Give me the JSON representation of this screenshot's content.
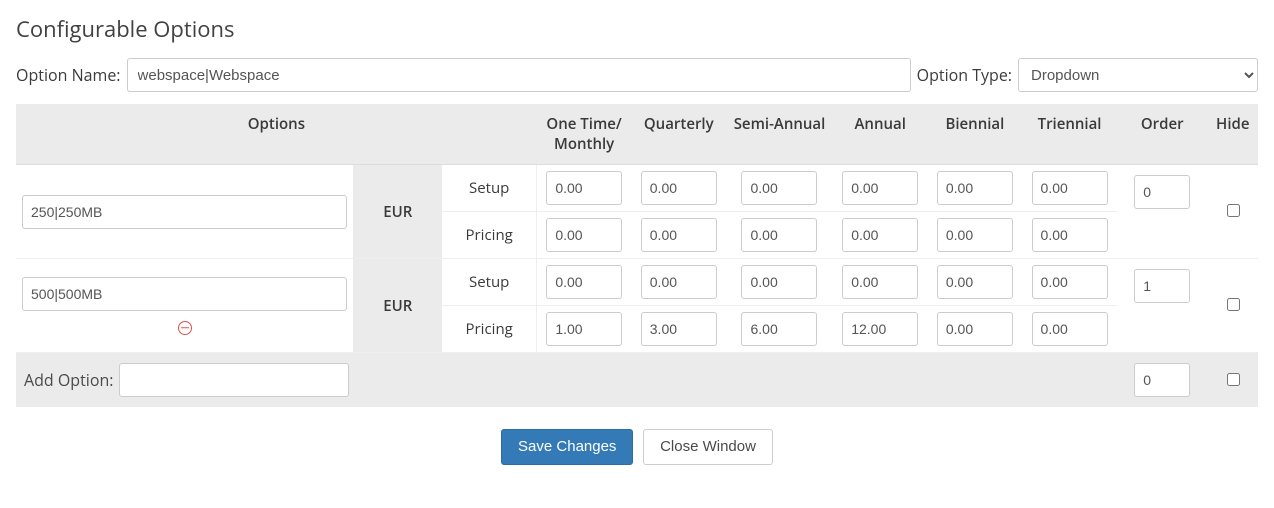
{
  "title": "Configurable Options",
  "labels": {
    "option_name": "Option Name:",
    "option_type": "Option Type:",
    "add_option": "Add Option:",
    "setup": "Setup",
    "pricing": "Pricing"
  },
  "option_name_value": "webspace|Webspace",
  "option_type_value": "Dropdown",
  "option_type_options": [
    "Dropdown"
  ],
  "headings": {
    "options": "Options",
    "one_time_monthly": "One Time/ Monthly",
    "quarterly": "Quarterly",
    "semi_annual": "Semi-Annual",
    "annual": "Annual",
    "biennial": "Biennial",
    "triennial": "Triennial",
    "order": "Order",
    "hide": "Hide"
  },
  "rows": [
    {
      "name": "250|250MB",
      "currency": "EUR",
      "setup": {
        "monthly": "0.00",
        "quarterly": "0.00",
        "semi": "0.00",
        "annual": "0.00",
        "biennial": "0.00",
        "triennial": "0.00"
      },
      "pricing": {
        "monthly": "0.00",
        "quarterly": "0.00",
        "semi": "0.00",
        "annual": "0.00",
        "biennial": "0.00",
        "triennial": "0.00"
      },
      "order": "0",
      "hide": false,
      "removable": false
    },
    {
      "name": "500|500MB",
      "currency": "EUR",
      "setup": {
        "monthly": "0.00",
        "quarterly": "0.00",
        "semi": "0.00",
        "annual": "0.00",
        "biennial": "0.00",
        "triennial": "0.00"
      },
      "pricing": {
        "monthly": "1.00",
        "quarterly": "3.00",
        "semi": "6.00",
        "annual": "12.00",
        "biennial": "0.00",
        "triennial": "0.00"
      },
      "order": "1",
      "hide": false,
      "removable": true
    }
  ],
  "add_option_value": "",
  "add_option_order": "0",
  "add_option_hide": false,
  "buttons": {
    "save": "Save Changes",
    "close": "Close Window"
  }
}
